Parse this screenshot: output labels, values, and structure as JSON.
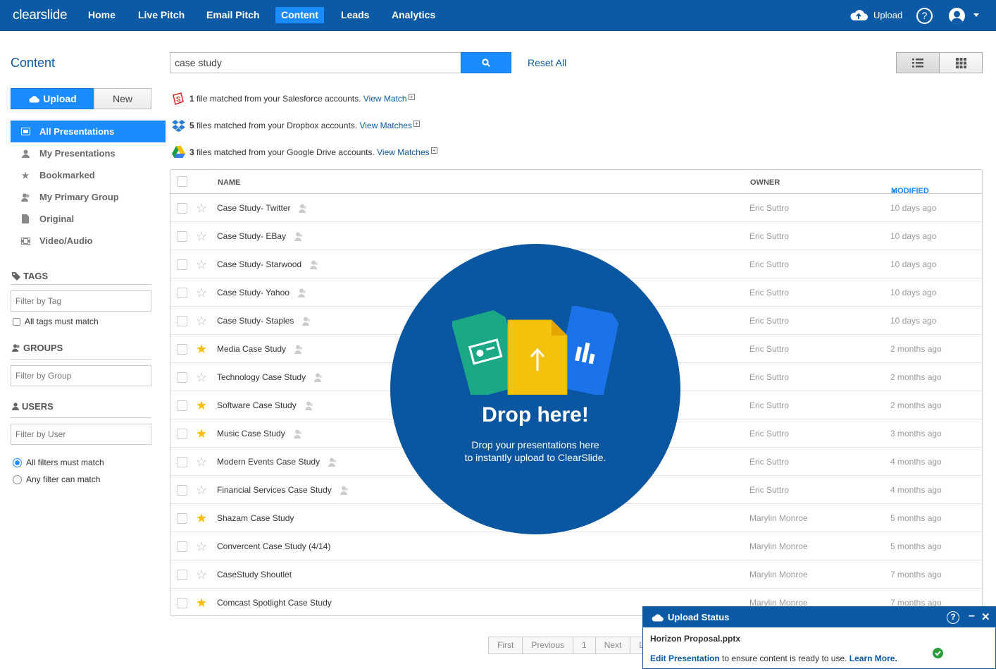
{
  "nav": {
    "logo": "clearslide",
    "items": [
      "Home",
      "Live Pitch",
      "Email Pitch",
      "Content",
      "Leads",
      "Analytics"
    ],
    "active": "Content",
    "upload_label": "Upload",
    "help_label": "?"
  },
  "sidebar": {
    "title": "Content",
    "upload_label": "Upload",
    "new_label": "New",
    "items": [
      {
        "label": "All Presentations",
        "icon": "presentation-icon",
        "active": true
      },
      {
        "label": "My Presentations",
        "icon": "person-icon"
      },
      {
        "label": "Bookmarked",
        "icon": "star-icon"
      },
      {
        "label": "My Primary Group",
        "icon": "group-icon"
      },
      {
        "label": "Original",
        "icon": "document-icon"
      },
      {
        "label": "Video/Audio",
        "icon": "film-icon"
      }
    ],
    "tags_head": "TAGS",
    "tag_placeholder": "Filter by Tag",
    "tags_match_label": "All tags must match",
    "groups_head": "GROUPS",
    "group_placeholder": "Filter by Group",
    "users_head": "USERS",
    "user_placeholder": "Filter by User",
    "all_filters_label": "All filters must match",
    "any_filter_label": "Any filter can match"
  },
  "search": {
    "value": "case study",
    "reset_label": "Reset All"
  },
  "matches": [
    {
      "icon": "salesforce-icon",
      "count": "1",
      "text": " file matched from your Salesforce accounts. ",
      "link": "View Match"
    },
    {
      "icon": "dropbox-icon",
      "count": "5",
      "text": " files matched from your Dropbox accounts. ",
      "link": "View Matches"
    },
    {
      "icon": "google-drive-icon",
      "count": "3",
      "text": " files matched from your Google Drive accounts. ",
      "link": "View Matches"
    }
  ],
  "table": {
    "headers": {
      "name": "NAME",
      "owner": "OWNER",
      "modified": "MODIFIED"
    },
    "rows": [
      {
        "name": "Case Study- Twitter",
        "owner": "Eric Suttro",
        "modified": "10 days ago",
        "starred": false,
        "shared": true
      },
      {
        "name": "Case Study- EBay",
        "owner": "Eric Suttro",
        "modified": "10 days ago",
        "starred": false,
        "shared": true
      },
      {
        "name": "Case Study- Starwood",
        "owner": "Eric Suttro",
        "modified": "10 days ago",
        "starred": false,
        "shared": true
      },
      {
        "name": "Case Study- Yahoo",
        "owner": "Eric Suttro",
        "modified": "10 days ago",
        "starred": false,
        "shared": true
      },
      {
        "name": "Case Study- Staples",
        "owner": "Eric Suttro",
        "modified": "10 days ago",
        "starred": false,
        "shared": true
      },
      {
        "name": "Media Case Study",
        "owner": "Eric Suttro",
        "modified": "2 months ago",
        "starred": true,
        "shared": true
      },
      {
        "name": "Technology Case Study",
        "owner": "Eric Suttro",
        "modified": "2 months ago",
        "starred": false,
        "shared": true
      },
      {
        "name": "Software Case Study",
        "owner": "Eric Suttro",
        "modified": "2 months ago",
        "starred": true,
        "shared": true
      },
      {
        "name": "Music Case Study",
        "owner": "Eric Suttro",
        "modified": "3 months ago",
        "starred": true,
        "shared": true
      },
      {
        "name": "Modern Events Case Study",
        "owner": "Eric Suttro",
        "modified": "4 months ago",
        "starred": false,
        "shared": true
      },
      {
        "name": "Financial Services Case Study",
        "owner": "Eric Suttro",
        "modified": "4 months ago",
        "starred": false,
        "shared": true
      },
      {
        "name": "Shazam Case Study",
        "owner": "Marylin Monroe",
        "modified": "5 months ago",
        "starred": true,
        "shared": false
      },
      {
        "name": "Convercent Case Study (4/14)",
        "owner": "Marylin Monroe",
        "modified": "5 months ago",
        "starred": false,
        "shared": false
      },
      {
        "name": "CaseStudy Shoutlet",
        "owner": "Marylin Monroe",
        "modified": "7 months ago",
        "starred": false,
        "shared": false
      },
      {
        "name": "Comcast Spotlight Case Study",
        "owner": "Marylin Monroe",
        "modified": "7 months ago",
        "starred": true,
        "shared": false
      }
    ]
  },
  "drop": {
    "title": "Drop here!",
    "line1": "Drop your presentations here",
    "line2": "to instantly upload to ClearSlide."
  },
  "pager": [
    "First",
    "Previous",
    "1",
    "Next",
    "L"
  ],
  "upload_status": {
    "title": "Upload Status",
    "file": "Horizon Proposal.pptx",
    "link": "Edit Presentation",
    "msg": " to ensure content is ready to use. ",
    "learn": "Learn More."
  },
  "colors": {
    "nav_bg": "#0c5aa6",
    "accent": "#1a8cff",
    "star": "#f6c000",
    "drop_bg": "#0a56a0"
  }
}
